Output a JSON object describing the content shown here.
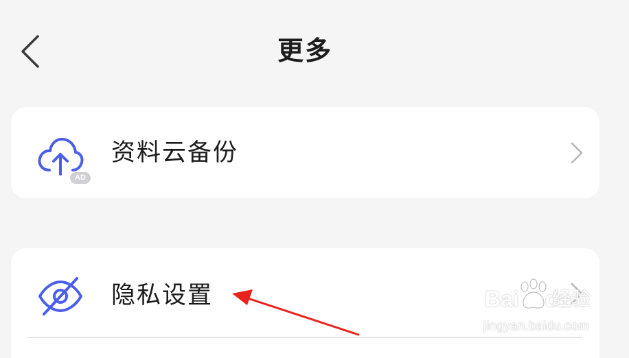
{
  "header": {
    "title": "更多",
    "back_icon": "chevron-left-icon"
  },
  "items": [
    {
      "label": "资料云备份",
      "icon": "cloud-upload-icon",
      "badge": "AD",
      "chevron_icon": "chevron-right-icon"
    },
    {
      "label": "隐私设置",
      "icon": "eye-off-icon",
      "chevron_icon": "chevron-right-icon"
    }
  ],
  "annotation": {
    "type": "arrow",
    "color": "#e8231d",
    "points_to": "隐私设置"
  },
  "watermark": {
    "brand": "Bai",
    "brand_suffix": "du",
    "cn": "经验",
    "url": "jingyan.baidu.com"
  },
  "colors": {
    "background": "#f5f5f5",
    "card": "#ffffff",
    "icon_accent": "#4a5ee8",
    "chevron": "#b5b5b5",
    "arrow": "#e8231d"
  }
}
